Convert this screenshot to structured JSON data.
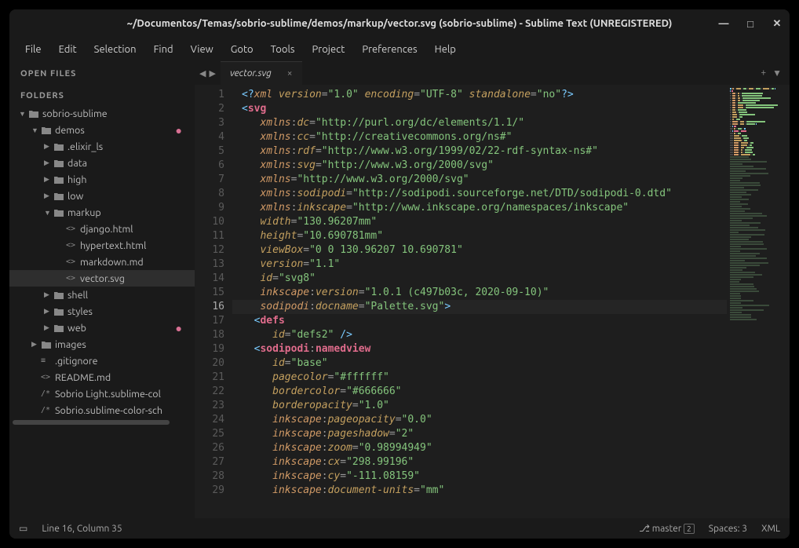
{
  "title": "~/Documentos/Temas/sobrio-sublime/demos/markup/vector.svg (sobrio-sublime) - Sublime Text (UNREGISTERED)",
  "menu": [
    "File",
    "Edit",
    "Selection",
    "Find",
    "View",
    "Goto",
    "Tools",
    "Project",
    "Preferences",
    "Help"
  ],
  "sidebar": {
    "open_files_h": "OPEN FILES",
    "folders_h": "FOLDERS",
    "tree": [
      {
        "ind": 0,
        "type": "folder",
        "open": true,
        "label": "sobrio-sublime"
      },
      {
        "ind": 1,
        "type": "folder",
        "open": true,
        "label": "demos",
        "dot": true
      },
      {
        "ind": 2,
        "type": "folder",
        "open": false,
        "label": ".elixir_ls"
      },
      {
        "ind": 2,
        "type": "folder",
        "open": false,
        "label": "data"
      },
      {
        "ind": 2,
        "type": "folder",
        "open": false,
        "label": "high"
      },
      {
        "ind": 2,
        "type": "folder",
        "open": false,
        "label": "low"
      },
      {
        "ind": 2,
        "type": "folder",
        "open": true,
        "label": "markup"
      },
      {
        "ind": 3,
        "type": "file",
        "icon": "<>",
        "label": "django.html"
      },
      {
        "ind": 3,
        "type": "file",
        "icon": "<>",
        "label": "hypertext.html"
      },
      {
        "ind": 3,
        "type": "file",
        "icon": "<>",
        "label": "markdown.md"
      },
      {
        "ind": 3,
        "type": "file",
        "icon": "<>",
        "label": "vector.svg",
        "sel": true
      },
      {
        "ind": 2,
        "type": "folder",
        "open": false,
        "label": "shell"
      },
      {
        "ind": 2,
        "type": "folder",
        "open": false,
        "label": "styles"
      },
      {
        "ind": 2,
        "type": "folder",
        "open": false,
        "label": "web",
        "dot": true
      },
      {
        "ind": 1,
        "type": "folder",
        "open": false,
        "label": "images"
      },
      {
        "ind": 1,
        "type": "file",
        "icon": "≡",
        "label": ".gitignore"
      },
      {
        "ind": 1,
        "type": "file",
        "icon": "<>",
        "label": "README.md"
      },
      {
        "ind": 1,
        "type": "file",
        "icon": "/*",
        "label": "Sobrio Light.sublime-col"
      },
      {
        "ind": 1,
        "type": "file",
        "icon": "/*",
        "label": "Sobrio.sublime-color-sch"
      }
    ]
  },
  "tab": {
    "name": "vector.svg"
  },
  "lines": 29,
  "current_line": 16,
  "code": [
    [
      [
        "p",
        "<?"
      ],
      [
        "pi",
        "xml"
      ],
      [
        "d",
        " "
      ],
      [
        "a",
        "version"
      ],
      [
        "d",
        "="
      ],
      [
        "v",
        "\"1.0\""
      ],
      [
        "d",
        " "
      ],
      [
        "a",
        "encoding"
      ],
      [
        "d",
        "="
      ],
      [
        "v",
        "\"UTF-8\""
      ],
      [
        "d",
        " "
      ],
      [
        "a",
        "standalone"
      ],
      [
        "d",
        "="
      ],
      [
        "v",
        "\"no\""
      ],
      [
        "p",
        "?>"
      ]
    ],
    [
      [
        "p",
        "<"
      ],
      [
        "t",
        "svg"
      ]
    ],
    [
      [
        "d",
        "   "
      ],
      [
        "ns",
        "xmlns"
      ],
      [
        "d",
        ":"
      ],
      [
        "a",
        "dc"
      ],
      [
        "d",
        "="
      ],
      [
        "v",
        "\"http://purl.org/dc/elements/1.1/\""
      ]
    ],
    [
      [
        "d",
        "   "
      ],
      [
        "ns",
        "xmlns"
      ],
      [
        "d",
        ":"
      ],
      [
        "a",
        "cc"
      ],
      [
        "d",
        "="
      ],
      [
        "v",
        "\"http://creativecommons.org/ns#\""
      ]
    ],
    [
      [
        "d",
        "   "
      ],
      [
        "ns",
        "xmlns"
      ],
      [
        "d",
        ":"
      ],
      [
        "a",
        "rdf"
      ],
      [
        "d",
        "="
      ],
      [
        "v",
        "\"http://www.w3.org/1999/02/22-rdf-syntax-ns#\""
      ]
    ],
    [
      [
        "d",
        "   "
      ],
      [
        "ns",
        "xmlns"
      ],
      [
        "d",
        ":"
      ],
      [
        "a",
        "svg"
      ],
      [
        "d",
        "="
      ],
      [
        "v",
        "\"http://www.w3.org/2000/svg\""
      ]
    ],
    [
      [
        "d",
        "   "
      ],
      [
        "ns",
        "xmlns"
      ],
      [
        "d",
        "="
      ],
      [
        "v",
        "\"http://www.w3.org/2000/svg\""
      ]
    ],
    [
      [
        "d",
        "   "
      ],
      [
        "ns",
        "xmlns"
      ],
      [
        "d",
        ":"
      ],
      [
        "a",
        "sodipodi"
      ],
      [
        "d",
        "="
      ],
      [
        "v",
        "\"http://sodipodi.sourceforge.net/DTD/sodipodi-0.dtd\""
      ]
    ],
    [
      [
        "d",
        "   "
      ],
      [
        "ns",
        "xmlns"
      ],
      [
        "d",
        ":"
      ],
      [
        "a",
        "inkscape"
      ],
      [
        "d",
        "="
      ],
      [
        "v",
        "\"http://www.inkscape.org/namespaces/inkscape\""
      ]
    ],
    [
      [
        "d",
        "   "
      ],
      [
        "a",
        "width"
      ],
      [
        "d",
        "="
      ],
      [
        "v",
        "\"130.96207mm\""
      ]
    ],
    [
      [
        "d",
        "   "
      ],
      [
        "a",
        "height"
      ],
      [
        "d",
        "="
      ],
      [
        "v",
        "\"10.690781mm\""
      ]
    ],
    [
      [
        "d",
        "   "
      ],
      [
        "a",
        "viewBox"
      ],
      [
        "d",
        "="
      ],
      [
        "v",
        "\"0 0 130.96207 10.690781\""
      ]
    ],
    [
      [
        "d",
        "   "
      ],
      [
        "a",
        "version"
      ],
      [
        "d",
        "="
      ],
      [
        "v",
        "\"1.1\""
      ]
    ],
    [
      [
        "d",
        "   "
      ],
      [
        "a",
        "id"
      ],
      [
        "d",
        "="
      ],
      [
        "v",
        "\"svg8\""
      ]
    ],
    [
      [
        "d",
        "   "
      ],
      [
        "ns",
        "inkscape"
      ],
      [
        "d",
        ":"
      ],
      [
        "a",
        "version"
      ],
      [
        "d",
        "="
      ],
      [
        "v",
        "\"1.0.1 (c497b03c, 2020-09-10)\""
      ]
    ],
    [
      [
        "d",
        "   "
      ],
      [
        "ns",
        "sodipodi"
      ],
      [
        "d",
        ":"
      ],
      [
        "a",
        "docname"
      ],
      [
        "d",
        "="
      ],
      [
        "v",
        "\"Palette.svg\""
      ],
      [
        "p",
        ">"
      ]
    ],
    [
      [
        "d",
        "  "
      ],
      [
        "p",
        "<"
      ],
      [
        "t",
        "defs"
      ]
    ],
    [
      [
        "d",
        "     "
      ],
      [
        "a",
        "id"
      ],
      [
        "d",
        "="
      ],
      [
        "v",
        "\"defs2\""
      ],
      [
        "d",
        " "
      ],
      [
        "p",
        "/>"
      ]
    ],
    [
      [
        "d",
        "  "
      ],
      [
        "p",
        "<"
      ],
      [
        "t",
        "sodipodi"
      ],
      [
        "d",
        ":"
      ],
      [
        "t",
        "namedview"
      ]
    ],
    [
      [
        "d",
        "     "
      ],
      [
        "a",
        "id"
      ],
      [
        "d",
        "="
      ],
      [
        "v",
        "\"base\""
      ]
    ],
    [
      [
        "d",
        "     "
      ],
      [
        "a",
        "pagecolor"
      ],
      [
        "d",
        "="
      ],
      [
        "v",
        "\"#ffffff\""
      ]
    ],
    [
      [
        "d",
        "     "
      ],
      [
        "a",
        "bordercolor"
      ],
      [
        "d",
        "="
      ],
      [
        "v",
        "\"#666666\""
      ]
    ],
    [
      [
        "d",
        "     "
      ],
      [
        "a",
        "borderopacity"
      ],
      [
        "d",
        "="
      ],
      [
        "v",
        "\"1.0\""
      ]
    ],
    [
      [
        "d",
        "     "
      ],
      [
        "ns",
        "inkscape"
      ],
      [
        "d",
        ":"
      ],
      [
        "a",
        "pageopacity"
      ],
      [
        "d",
        "="
      ],
      [
        "v",
        "\"0.0\""
      ]
    ],
    [
      [
        "d",
        "     "
      ],
      [
        "ns",
        "inkscape"
      ],
      [
        "d",
        ":"
      ],
      [
        "a",
        "pageshadow"
      ],
      [
        "d",
        "="
      ],
      [
        "v",
        "\"2\""
      ]
    ],
    [
      [
        "d",
        "     "
      ],
      [
        "ns",
        "inkscape"
      ],
      [
        "d",
        ":"
      ],
      [
        "a",
        "zoom"
      ],
      [
        "d",
        "="
      ],
      [
        "v",
        "\"0.98994949\""
      ]
    ],
    [
      [
        "d",
        "     "
      ],
      [
        "ns",
        "inkscape"
      ],
      [
        "d",
        ":"
      ],
      [
        "a",
        "cx"
      ],
      [
        "d",
        "="
      ],
      [
        "v",
        "\"298.99196\""
      ]
    ],
    [
      [
        "d",
        "     "
      ],
      [
        "ns",
        "inkscape"
      ],
      [
        "d",
        ":"
      ],
      [
        "a",
        "cy"
      ],
      [
        "d",
        "="
      ],
      [
        "v",
        "\"-111.08159\""
      ]
    ],
    [
      [
        "d",
        "     "
      ],
      [
        "ns",
        "inkscape"
      ],
      [
        "d",
        ":"
      ],
      [
        "a",
        "document-units"
      ],
      [
        "d",
        "="
      ],
      [
        "v",
        "\"mm\""
      ]
    ]
  ],
  "status": {
    "cursor": "Line 16, Column 35",
    "branch": "master",
    "branch_badge": "2",
    "spaces": "Spaces: 3",
    "syntax": "XML"
  }
}
